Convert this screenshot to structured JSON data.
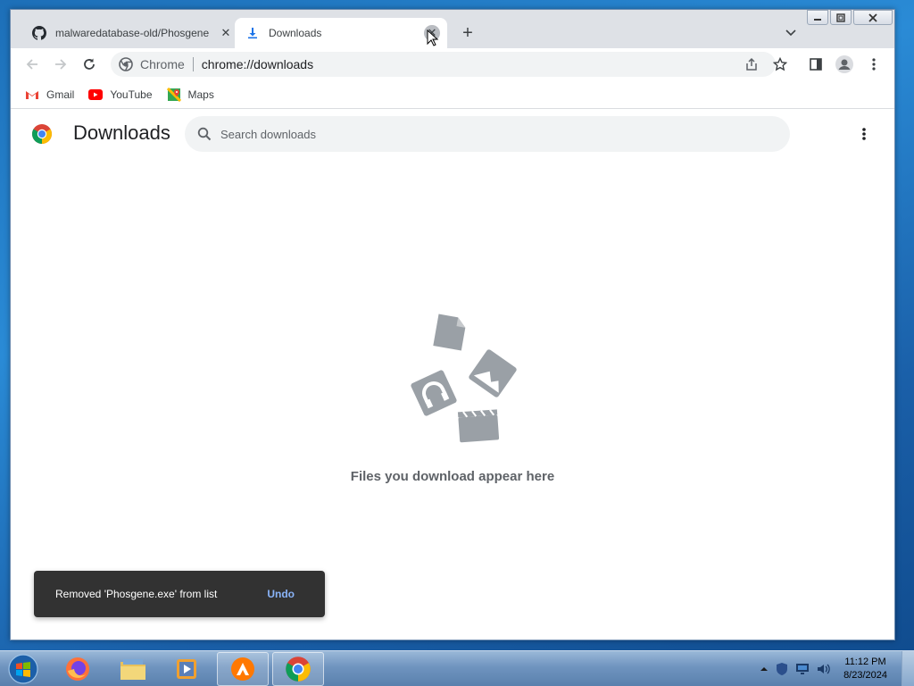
{
  "tabs": [
    {
      "title": "malwaredatabase-old/Phosgene",
      "close": "✕"
    },
    {
      "title": "Downloads",
      "close": "✕"
    }
  ],
  "newtab_label": "+",
  "omnibox": {
    "site_label": "Chrome",
    "url": "chrome://downloads"
  },
  "bookmarks": [
    {
      "label": "Gmail",
      "icon": "gmail-icon"
    },
    {
      "label": "YouTube",
      "icon": "youtube-icon"
    },
    {
      "label": "Maps",
      "icon": "maps-icon"
    }
  ],
  "downloads": {
    "title": "Downloads",
    "search_placeholder": "Search downloads",
    "empty_message": "Files you download appear here"
  },
  "toast": {
    "message": "Removed 'Phosgene.exe' from list",
    "action": "Undo"
  },
  "taskbar": {
    "items": [
      "start-orb",
      "firefox",
      "explorer",
      "media-player",
      "avast",
      "chrome"
    ],
    "clock": {
      "time": "11:12 PM",
      "date": "8/23/2024"
    }
  },
  "colors": {
    "accent": "#1a73e8",
    "toast_bg": "#323232",
    "undo": "#8ab4f8"
  }
}
